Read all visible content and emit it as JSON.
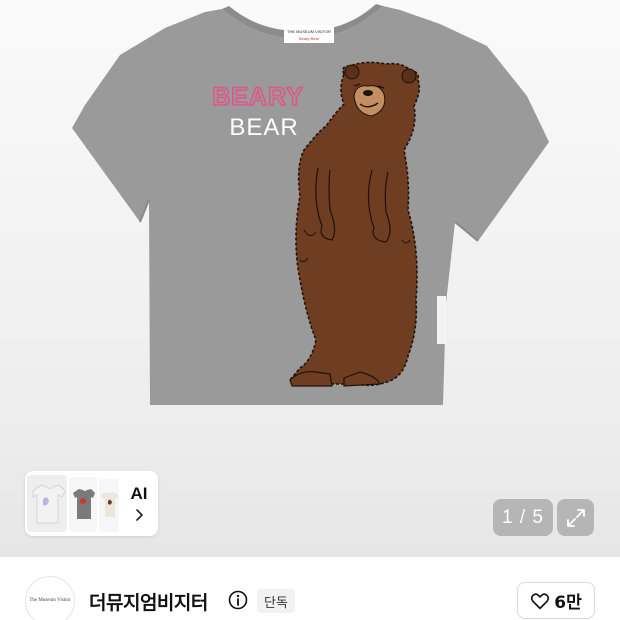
{
  "product": {
    "image_alt": "BEARY BEAR",
    "print_line1": "BEARY",
    "print_line2": "BEAR",
    "tag_text": "THE MUSEUM VISITOR",
    "tag_subtext": "Beary Bear",
    "side_label": "THE MUSEUM VISITOR"
  },
  "gallery": {
    "ai_label": "AI",
    "counter": "1 / 5"
  },
  "brand": {
    "logo_text": "The Museum Visitor",
    "name": "더뮤지엄비지터",
    "badge": "단독"
  },
  "like": {
    "count": "6만"
  },
  "icons": {
    "thumb_chevron": "chevron-right-icon",
    "expand": "expand-icon",
    "info": "info-icon",
    "heart": "heart-icon"
  },
  "colors": {
    "shirt": "#9b9b9b",
    "bear": "#6e3d22",
    "bear_face": "#b98a5e",
    "print_pink": "#e0568a",
    "overlay": "#969696"
  }
}
